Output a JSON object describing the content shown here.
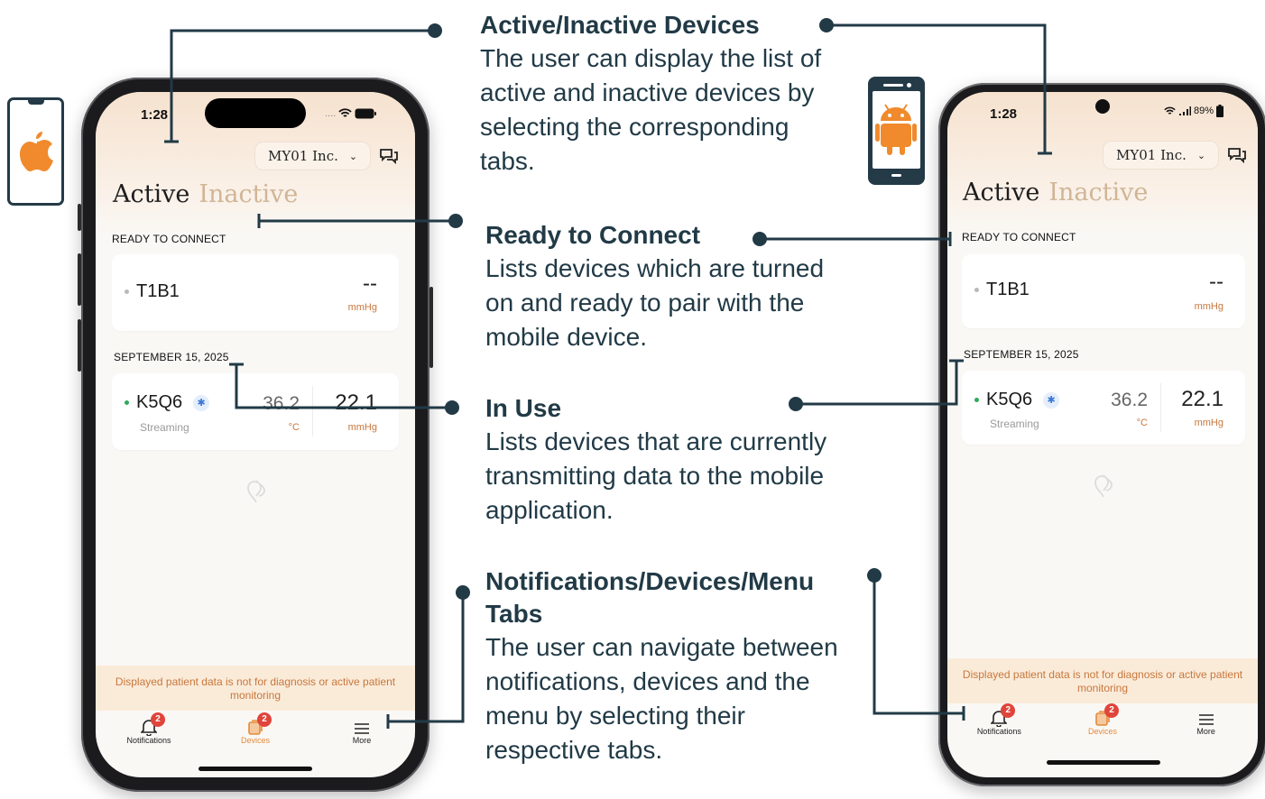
{
  "annotations": {
    "active_inactive": {
      "title": "Active/Inactive Devices",
      "body": "The user can display the list of active and inactive devices by selecting the corresponding tabs."
    },
    "ready": {
      "title": "Ready to Connect",
      "body": "Lists devices which are turned on and ready to pair with the mobile device."
    },
    "in_use": {
      "title": "In Use",
      "body": "Lists devices that are currently transmitting data to the mobile application."
    },
    "tabs": {
      "title": "Notifications/Devices/Menu Tabs",
      "body": "The user can navigate between notifications, devices and the menu by selecting their respective tabs."
    }
  },
  "platform_icons": {
    "ios": "apple-logo-icon",
    "android": "android-robot-icon"
  },
  "colors": {
    "accent": "#e58a3a",
    "inactive_tab": "#d0b596",
    "status_green": "#2faa5c",
    "badge_red": "#e0453b",
    "annotation": "#213a46",
    "banner_bg": "#faebd9"
  },
  "ios": {
    "status": {
      "time": "1:28",
      "signal": "....",
      "wifi_icon": "wifi-icon",
      "battery_icon": "battery-icon"
    },
    "org": {
      "label": "MY01 Inc."
    },
    "tabs": {
      "active": "Active",
      "inactive": "Inactive"
    },
    "ready_section": "READY TO CONNECT",
    "ready_device": {
      "name": "T1B1",
      "value": "--",
      "unit": "mmHg"
    },
    "date_section": "SEPTEMBER 15, 2025",
    "stream_device": {
      "name": "K5Q6",
      "status": "Streaming",
      "temp": "36.2",
      "temp_unit": "°C",
      "pressure": "22.1",
      "pressure_unit": "mmHg"
    },
    "banner": "Displayed patient data is not for diagnosis or active patient monitoring",
    "nav": [
      {
        "label": "Notifications",
        "badge": "2",
        "icon": "bell-icon"
      },
      {
        "label": "Devices",
        "badge": "2",
        "icon": "devices-icon"
      },
      {
        "label": "More",
        "icon": "menu-icon"
      }
    ]
  },
  "android": {
    "status": {
      "time": "1:28",
      "battery": "89%",
      "wifi_icon": "wifi-icon",
      "signal_icon": "signal-icon"
    },
    "org": {
      "label": "MY01 Inc."
    },
    "tabs": {
      "active": "Active",
      "inactive": "Inactive"
    },
    "ready_section": "READY TO CONNECT",
    "ready_device": {
      "name": "T1B1",
      "value": "--",
      "unit": "mmHg"
    },
    "date_section": "SEPTEMBER 15, 2025",
    "stream_device": {
      "name": "K5Q6",
      "status": "Streaming",
      "temp": "36.2",
      "temp_unit": "°C",
      "pressure": "22.1",
      "pressure_unit": "mmHg"
    },
    "banner": "Displayed patient data is not for diagnosis or active patient monitoring",
    "nav": [
      {
        "label": "Notifications",
        "badge": "2",
        "icon": "bell-icon"
      },
      {
        "label": "Devices",
        "badge": "2",
        "icon": "devices-icon"
      },
      {
        "label": "More",
        "icon": "menu-icon"
      }
    ]
  }
}
